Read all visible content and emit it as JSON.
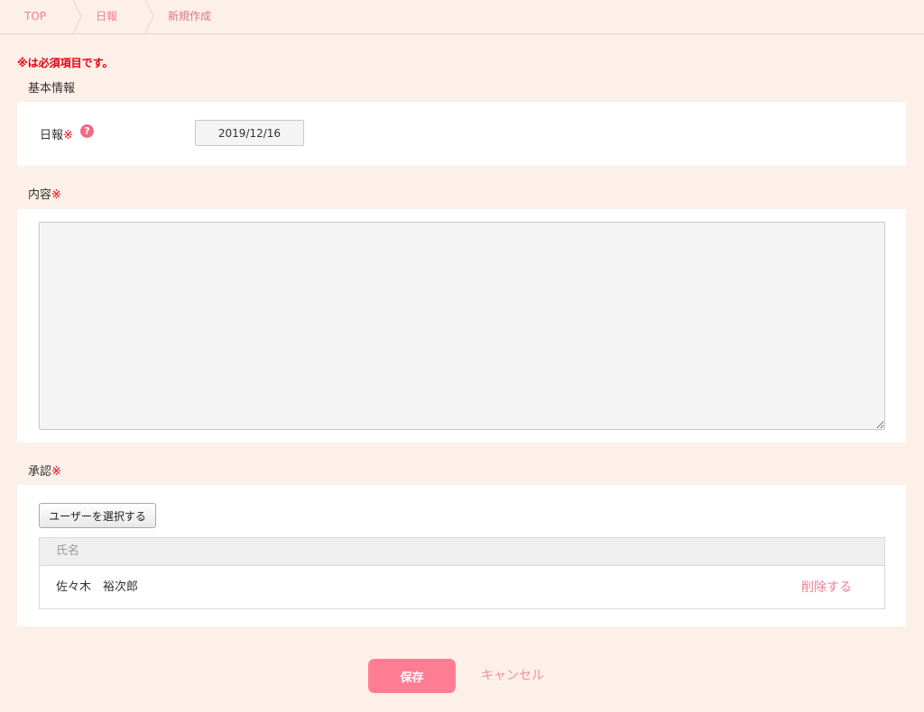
{
  "breadcrumb": {
    "items": [
      "TOP",
      "日報",
      "新規作成"
    ]
  },
  "form": {
    "required_note": "※は必須項目です。",
    "required_mark": "※",
    "basic_info": {
      "title": "基本情報",
      "date_label": "日報",
      "help_icon": "?",
      "date_value": "2019/12/16"
    },
    "content": {
      "title": "内容",
      "value": ""
    },
    "approval": {
      "title": "承認",
      "select_user_label": "ユーザーを選択する",
      "table_header_name": "氏名",
      "rows": [
        {
          "name": "佐々木　裕次郎",
          "delete_label": "削除する"
        }
      ]
    }
  },
  "actions": {
    "save_label": "保存",
    "cancel_label": "キャンセル"
  },
  "colors": {
    "background": "#fcf0e8",
    "accent": "#ff7d92",
    "link": "#f07f94",
    "required": "#e60012"
  }
}
